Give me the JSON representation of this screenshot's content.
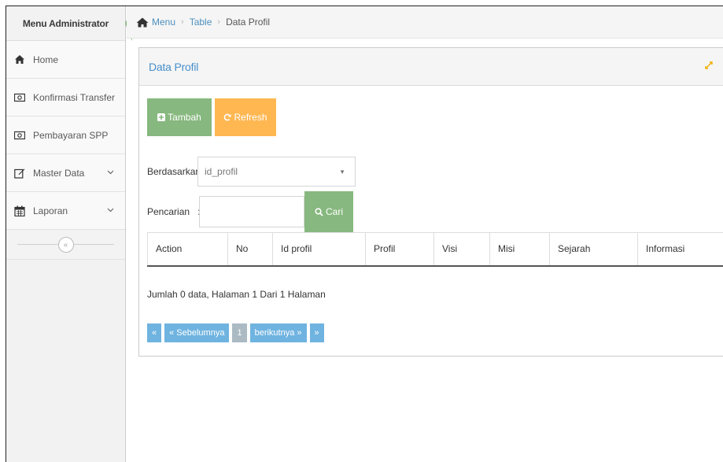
{
  "sidebar": {
    "title": "Menu Administrator",
    "items": [
      {
        "label": "Home",
        "icon": "home-icon",
        "expandable": false
      },
      {
        "label": "Konfirmasi Transfer",
        "icon": "money-icon",
        "expandable": false
      },
      {
        "label": "Pembayaran SPP",
        "icon": "money-icon",
        "expandable": false
      },
      {
        "label": "Master Data",
        "icon": "edit-icon",
        "expandable": true
      },
      {
        "label": "Laporan",
        "icon": "calendar-icon",
        "expandable": true
      }
    ],
    "collapse_icon": "double-chevron-left-icon"
  },
  "breadcrumb": {
    "items": [
      "Menu",
      "Table"
    ],
    "current": "Data Profil",
    "separator": "›"
  },
  "widget": {
    "title": "Data Profil",
    "add_label": "Tambah",
    "refresh_label": "Refresh",
    "filter_label": "Berdasarkan:",
    "filter_selected": "id_profil",
    "search_label": "Pencarian",
    "search_colon": ":",
    "search_value": "",
    "search_button_label": "Cari",
    "table": {
      "columns": [
        "Action",
        "No",
        "Id profil",
        "Profil",
        "Visi",
        "Misi",
        "Sejarah",
        "Informasi"
      ]
    },
    "info": "Jumlah 0 data, Halaman 1 Dari 1 Halaman",
    "pager": {
      "first": "«",
      "prev": "« Sebelumnya",
      "current": "1",
      "next": "berikutnya »",
      "last": "»"
    }
  },
  "colors": {
    "green": "#87b87f",
    "orange": "#ffb752",
    "blue": "#6fb3e0",
    "link": "#4c8fbd"
  }
}
